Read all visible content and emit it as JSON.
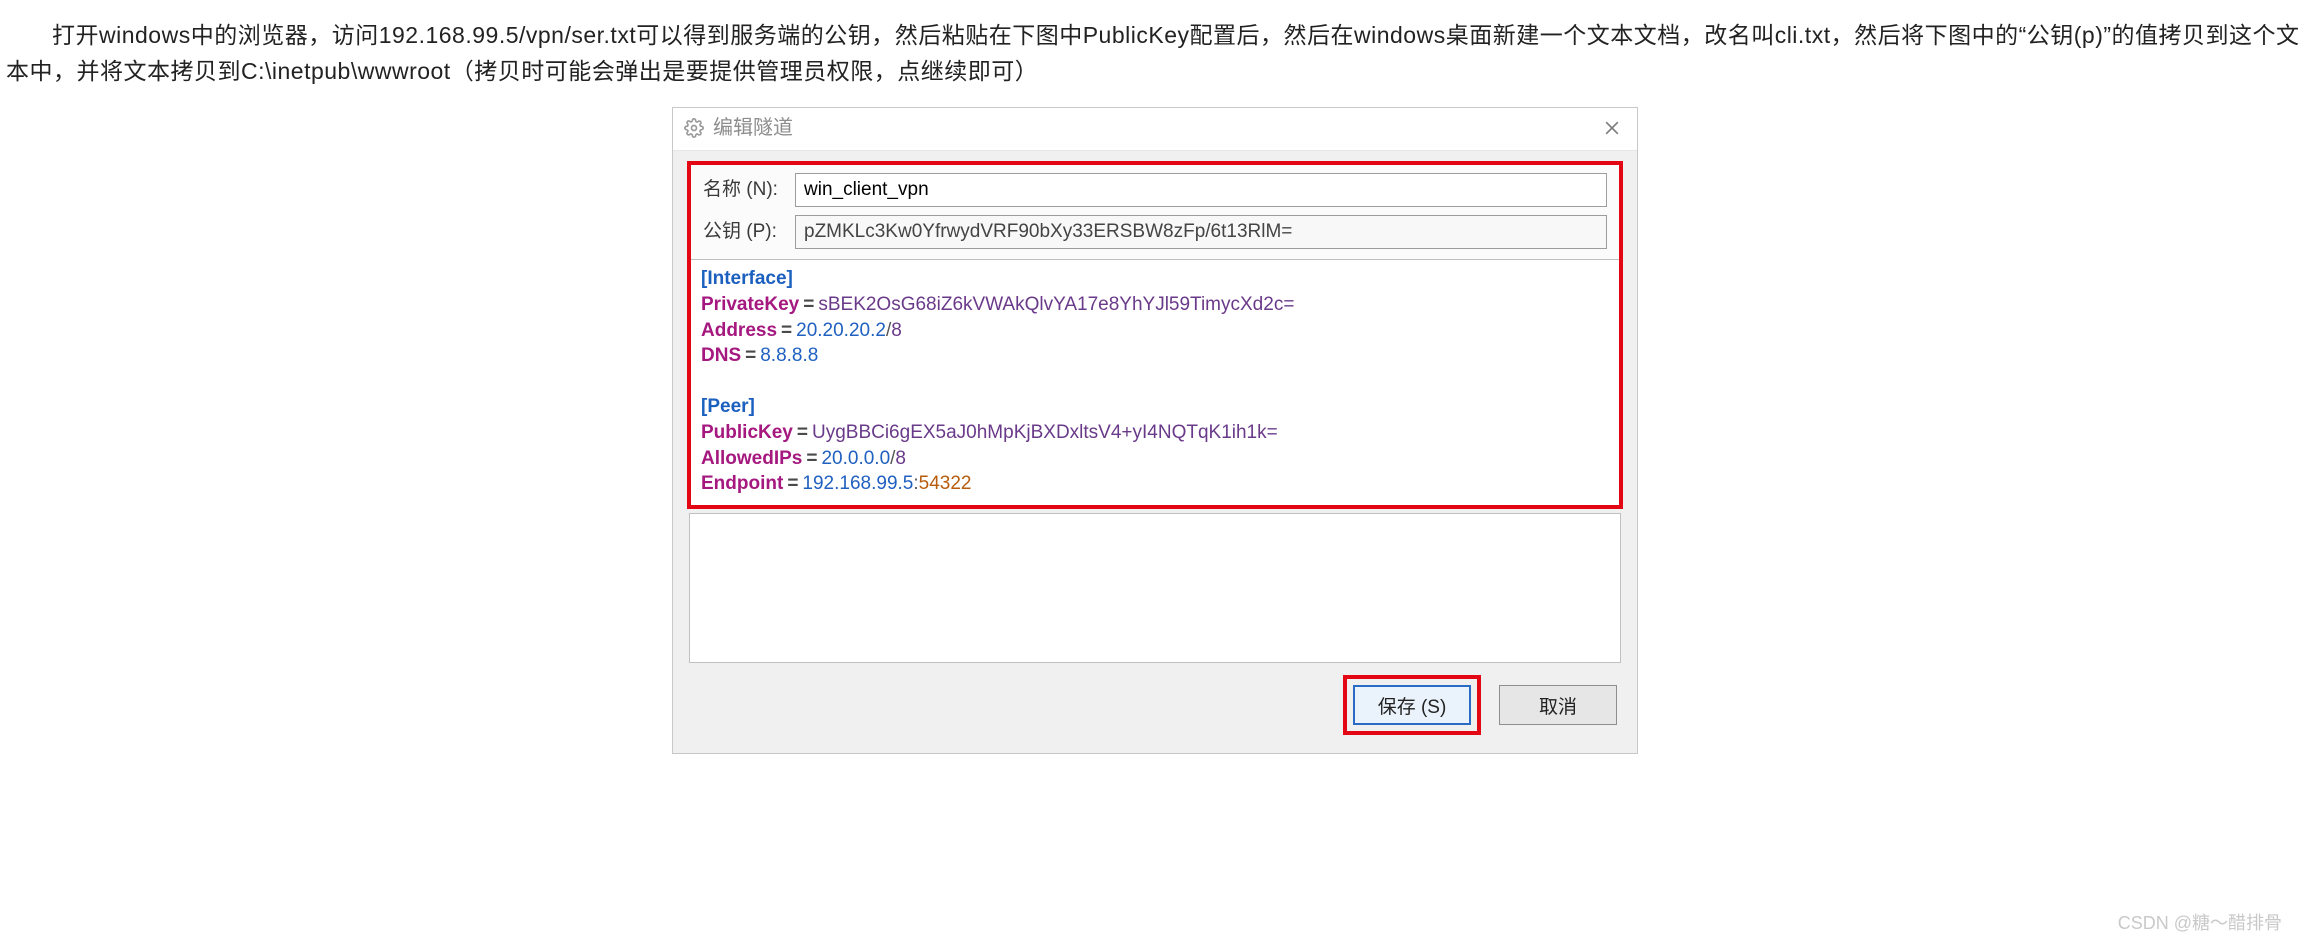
{
  "paragraph": "打开windows中的浏览器，访问192.168.99.5/vpn/ser.txt可以得到服务端的公钥，然后粘贴在下图中PublicKey配置后，然后在windows桌面新建一个文本文档，改名叫cli.txt，然后将下图中的“公钥(p)”的值拷贝到这个文本中，并将文本拷贝到C:\\inetpub\\wwwroot（拷贝时可能会弹出是要提供管理员权限，点继续即可）",
  "dialog": {
    "title": "编辑隧道",
    "name_label": "名称 (N):",
    "name_value": "win_client_vpn",
    "pubkey_label": "公钥 (P):",
    "pubkey_value": "pZMKLc3Kw0YfrwydVRF90bXy33ERSBW8zFp/6t13RlM=",
    "save_label": "保存 (S)",
    "cancel_label": "取消"
  },
  "config": {
    "interface_header": "[Interface]",
    "private_key_label": "PrivateKey",
    "private_key_value": "sBEK2OsG68iZ6kVWAkQlvYA17e8YhYJl59TimycXd2c=",
    "address_label": "Address",
    "address_ip": "20.20.20.2",
    "address_cidr": "8",
    "dns_label": "DNS",
    "dns_value": "8.8.8.8",
    "peer_header": "[Peer]",
    "public_key_label": "PublicKey",
    "public_key_value": "UygBBCi6gEX5aJ0hMpKjBXDxltsV4+yI4NQTqK1ih1k=",
    "allowed_ips_label": "AllowedIPs",
    "allowed_ips_ip": "20.0.0.0",
    "allowed_ips_cidr": "8",
    "endpoint_label": "Endpoint",
    "endpoint_ip": "192.168.99.5",
    "endpoint_port": "54322"
  },
  "watermark": "CSDN @糖～醋排骨"
}
